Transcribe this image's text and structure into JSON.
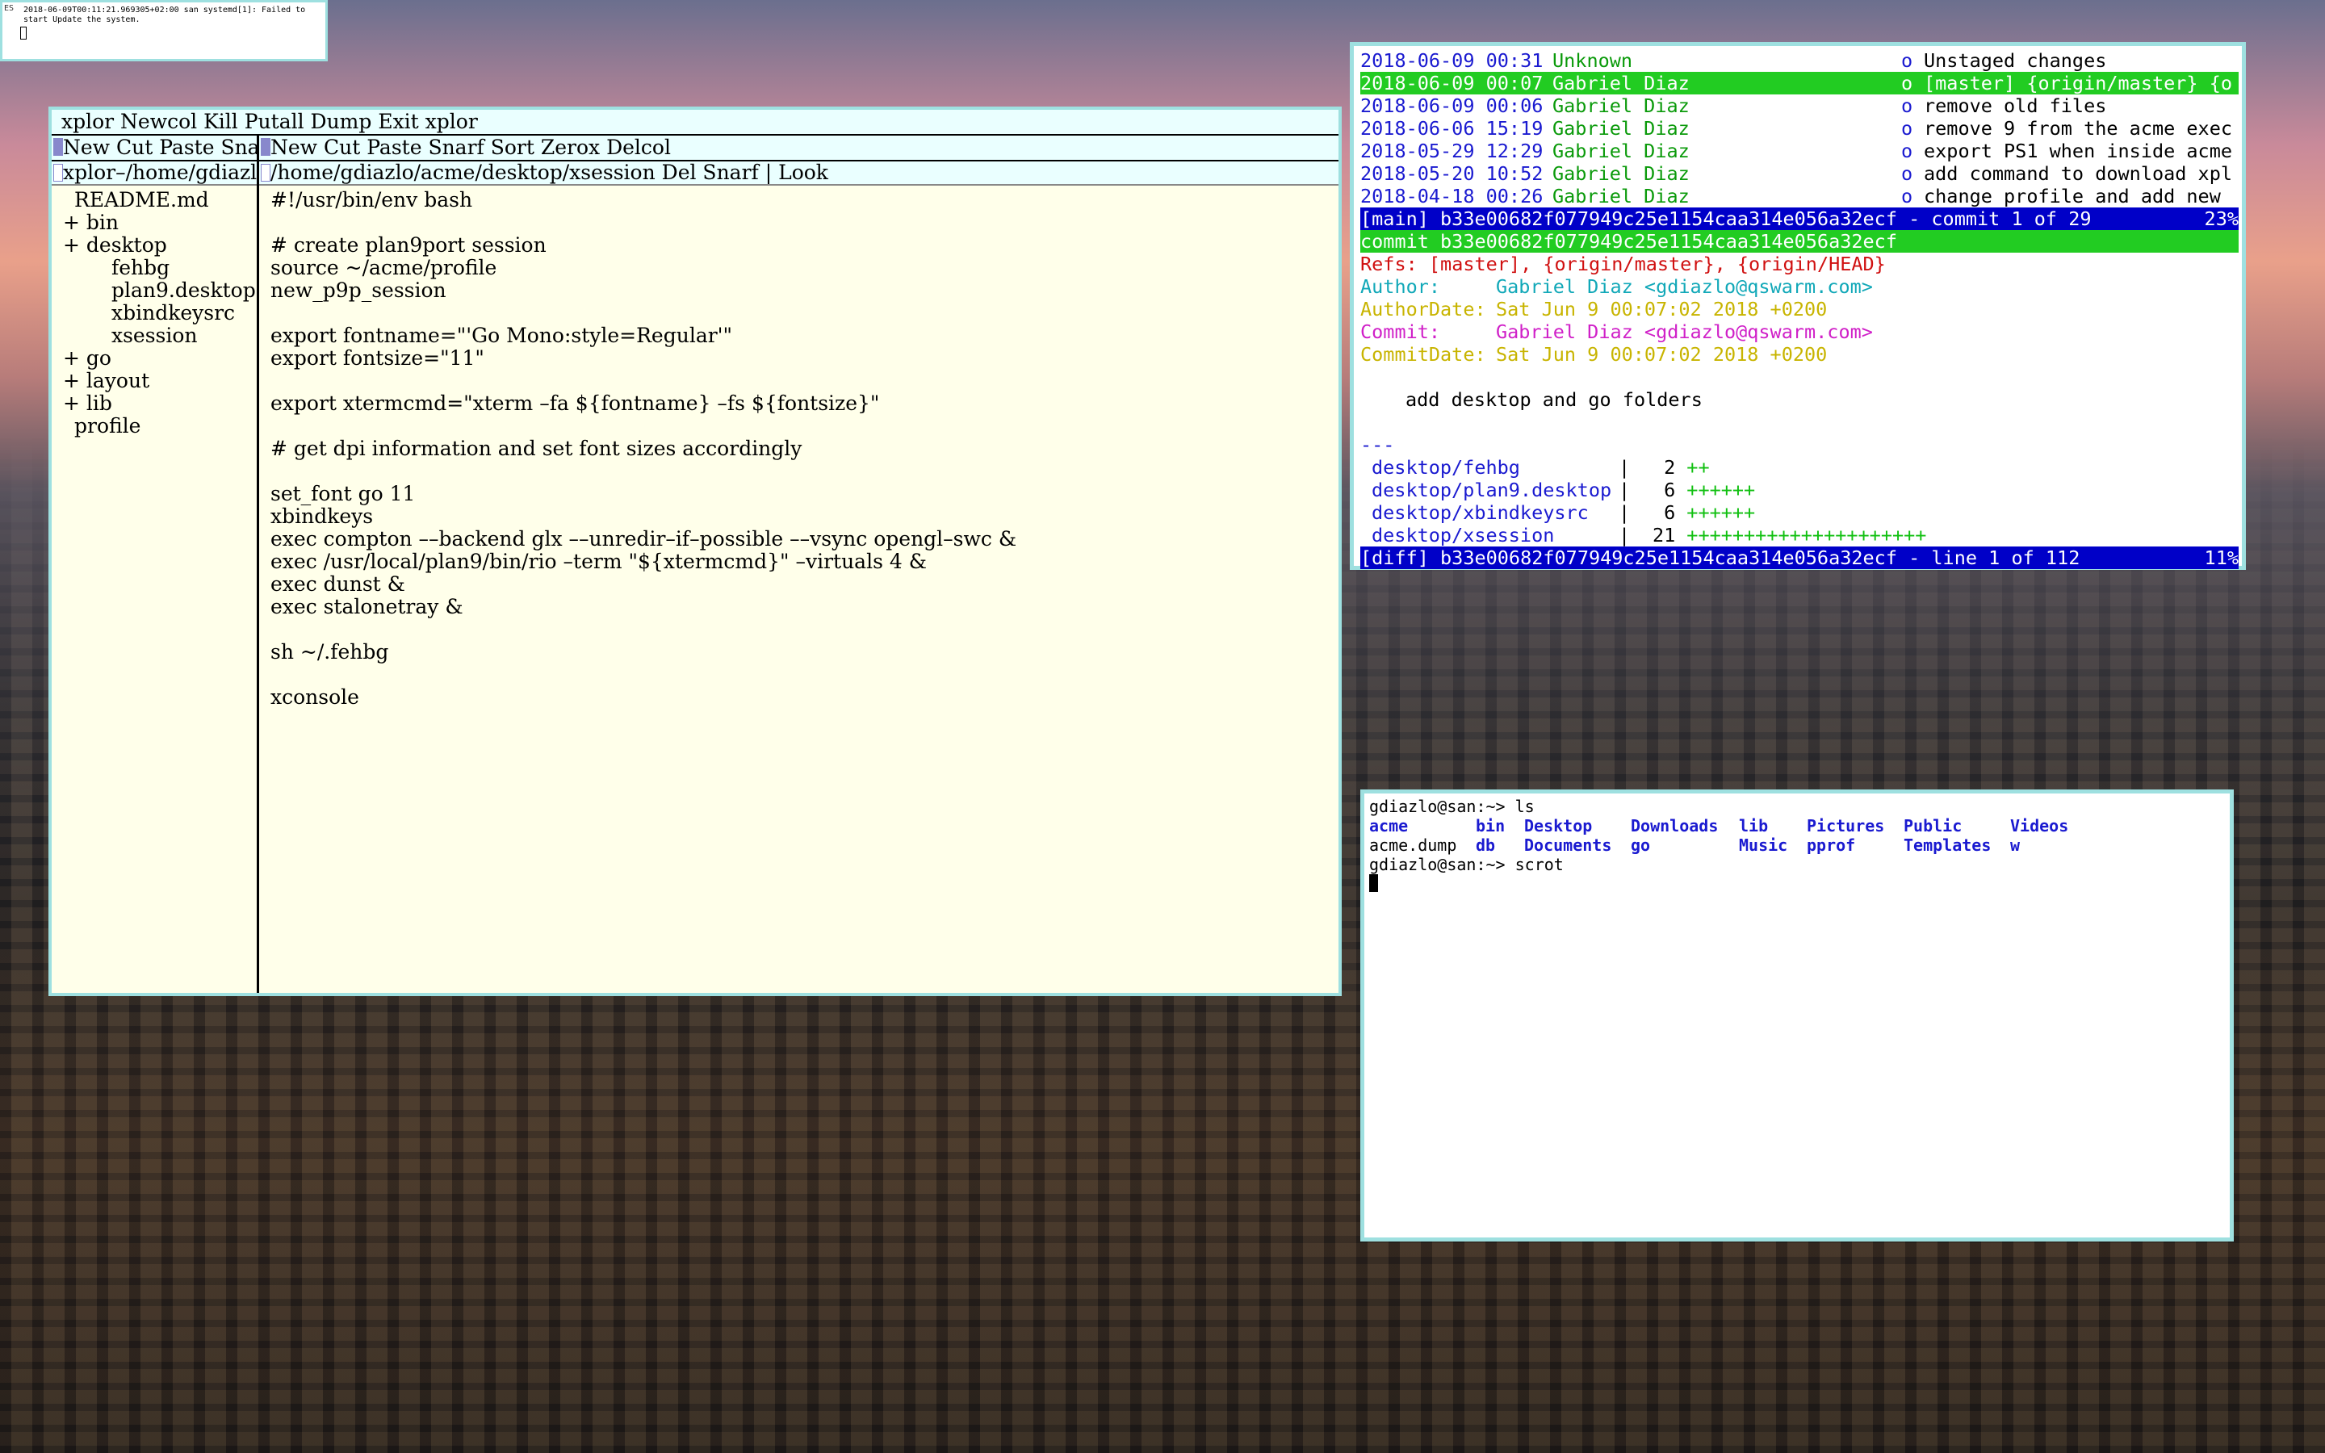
{
  "xconsole": {
    "label": "ES",
    "text": "2018-06-09T00:11:21.969305+02:00 san systemd[1]: Failed to start Update the system."
  },
  "acme": {
    "row_tag": "xplor Newcol Kill Putall Dump Exit xplor",
    "col1": {
      "tag": "New Cut Paste Sna",
      "win_tag": "xplor–/home/gdiazl",
      "tree": [
        "README.md",
        "+ bin",
        "+ desktop",
        "fehbg",
        "plan9.desktop",
        "xbindkeysrc",
        "xsession",
        "+ go",
        "+ layout",
        "+ lib",
        "profile"
      ]
    },
    "col2": {
      "tag": "New Cut Paste Snarf Sort Zerox Delcol",
      "win_tag": "/home/gdiazlo/acme/desktop/xsession Del Snarf | Look",
      "lines": [
        "#!/usr/bin/env bash",
        "",
        "# create plan9port session",
        "source ~/acme/profile",
        "new_p9p_session",
        "",
        "export fontname=\"'Go Mono:style=Regular'\"",
        "export fontsize=\"11\"",
        "",
        "export xtermcmd=\"xterm –fa ${fontname} –fs ${fontsize}\"",
        "",
        "# get dpi information and set font sizes accordingly",
        "",
        "set_font go 11",
        "xbindkeys",
        "exec compton ––backend glx ––unredir–if–possible ––vsync opengl–swc &",
        "exec /usr/local/plan9/bin/rio –term \"${xtermcmd}\" –virtuals 4 &",
        "exec dunst &",
        "exec stalonetray &",
        "",
        "sh ~/.fehbg",
        "",
        "xconsole"
      ]
    }
  },
  "tig": {
    "log": [
      {
        "date": "2018-06-09 00:31",
        "author": "Unknown",
        "mark": "o",
        "msg": "Unstaged changes"
      },
      {
        "date": "2018-06-09 00:07",
        "author": "Gabriel Diaz",
        "mark": "o",
        "msg": "[master] {origin/master} {o",
        "selected": true
      },
      {
        "date": "2018-06-09 00:06",
        "author": "Gabriel Diaz",
        "mark": "o",
        "msg": "remove old files"
      },
      {
        "date": "2018-06-06 15:19",
        "author": "Gabriel Diaz",
        "mark": "o",
        "msg": "remove 9 from the acme exec"
      },
      {
        "date": "2018-05-29 12:29",
        "author": "Gabriel Diaz",
        "mark": "o",
        "msg": "export PS1 when inside acme"
      },
      {
        "date": "2018-05-20 10:52",
        "author": "Gabriel Diaz",
        "mark": "o",
        "msg": "add command to download xpl"
      },
      {
        "date": "2018-04-18 00:26",
        "author": "Gabriel Diaz",
        "mark": "o",
        "msg": "change profile and add new"
      }
    ],
    "main_status": "[main] b33e00682f077949c25e1154caa314e056a32ecf - commit 1 of 29",
    "main_pct": "23%",
    "commit_line": "commit b33e00682f077949c25e1154caa314e056a32ecf",
    "refs_label": "Refs:",
    "refs_value": "[master], {origin/master}, {origin/HEAD}",
    "author_label": "Author:",
    "author_value": "Gabriel Diaz <gdiazlo@qswarm.com>",
    "authordate_label": "AuthorDate:",
    "authordate_value": "Sat Jun 9 00:07:02 2018 +0200",
    "committer_label": "Commit:",
    "committer_value": "Gabriel Diaz <gdiazlo@qswarm.com>",
    "commitdate_label": "CommitDate:",
    "commitdate_value": "Sat Jun 9 00:07:02 2018 +0200",
    "message": "add desktop and go folders",
    "separator": "---",
    "diffstat": [
      {
        "file": "desktop/fehbg",
        "count": "2",
        "bar": "++"
      },
      {
        "file": "desktop/plan9.desktop",
        "count": "6",
        "bar": "++++++"
      },
      {
        "file": "desktop/xbindkeysrc",
        "count": "6",
        "bar": "++++++"
      },
      {
        "file": "desktop/xsession",
        "count": "21",
        "bar": "+++++++++++++++++++++"
      }
    ],
    "diff_status": "[diff] b33e00682f077949c25e1154caa314e056a32ecf - line 1 of 112",
    "diff_pct": "11%"
  },
  "terminal": {
    "prompt1": "gdiazlo@san:~> ls",
    "ls_row1": [
      "acme",
      "bin",
      "Desktop",
      "Downloads",
      "lib",
      "Pictures",
      "Public",
      "Videos"
    ],
    "ls_row2": [
      "acme.dump",
      "db",
      "Documents",
      "go",
      "Music",
      "pprof",
      "Templates",
      "w"
    ],
    "prompt2": "gdiazlo@san:~> scrot"
  }
}
